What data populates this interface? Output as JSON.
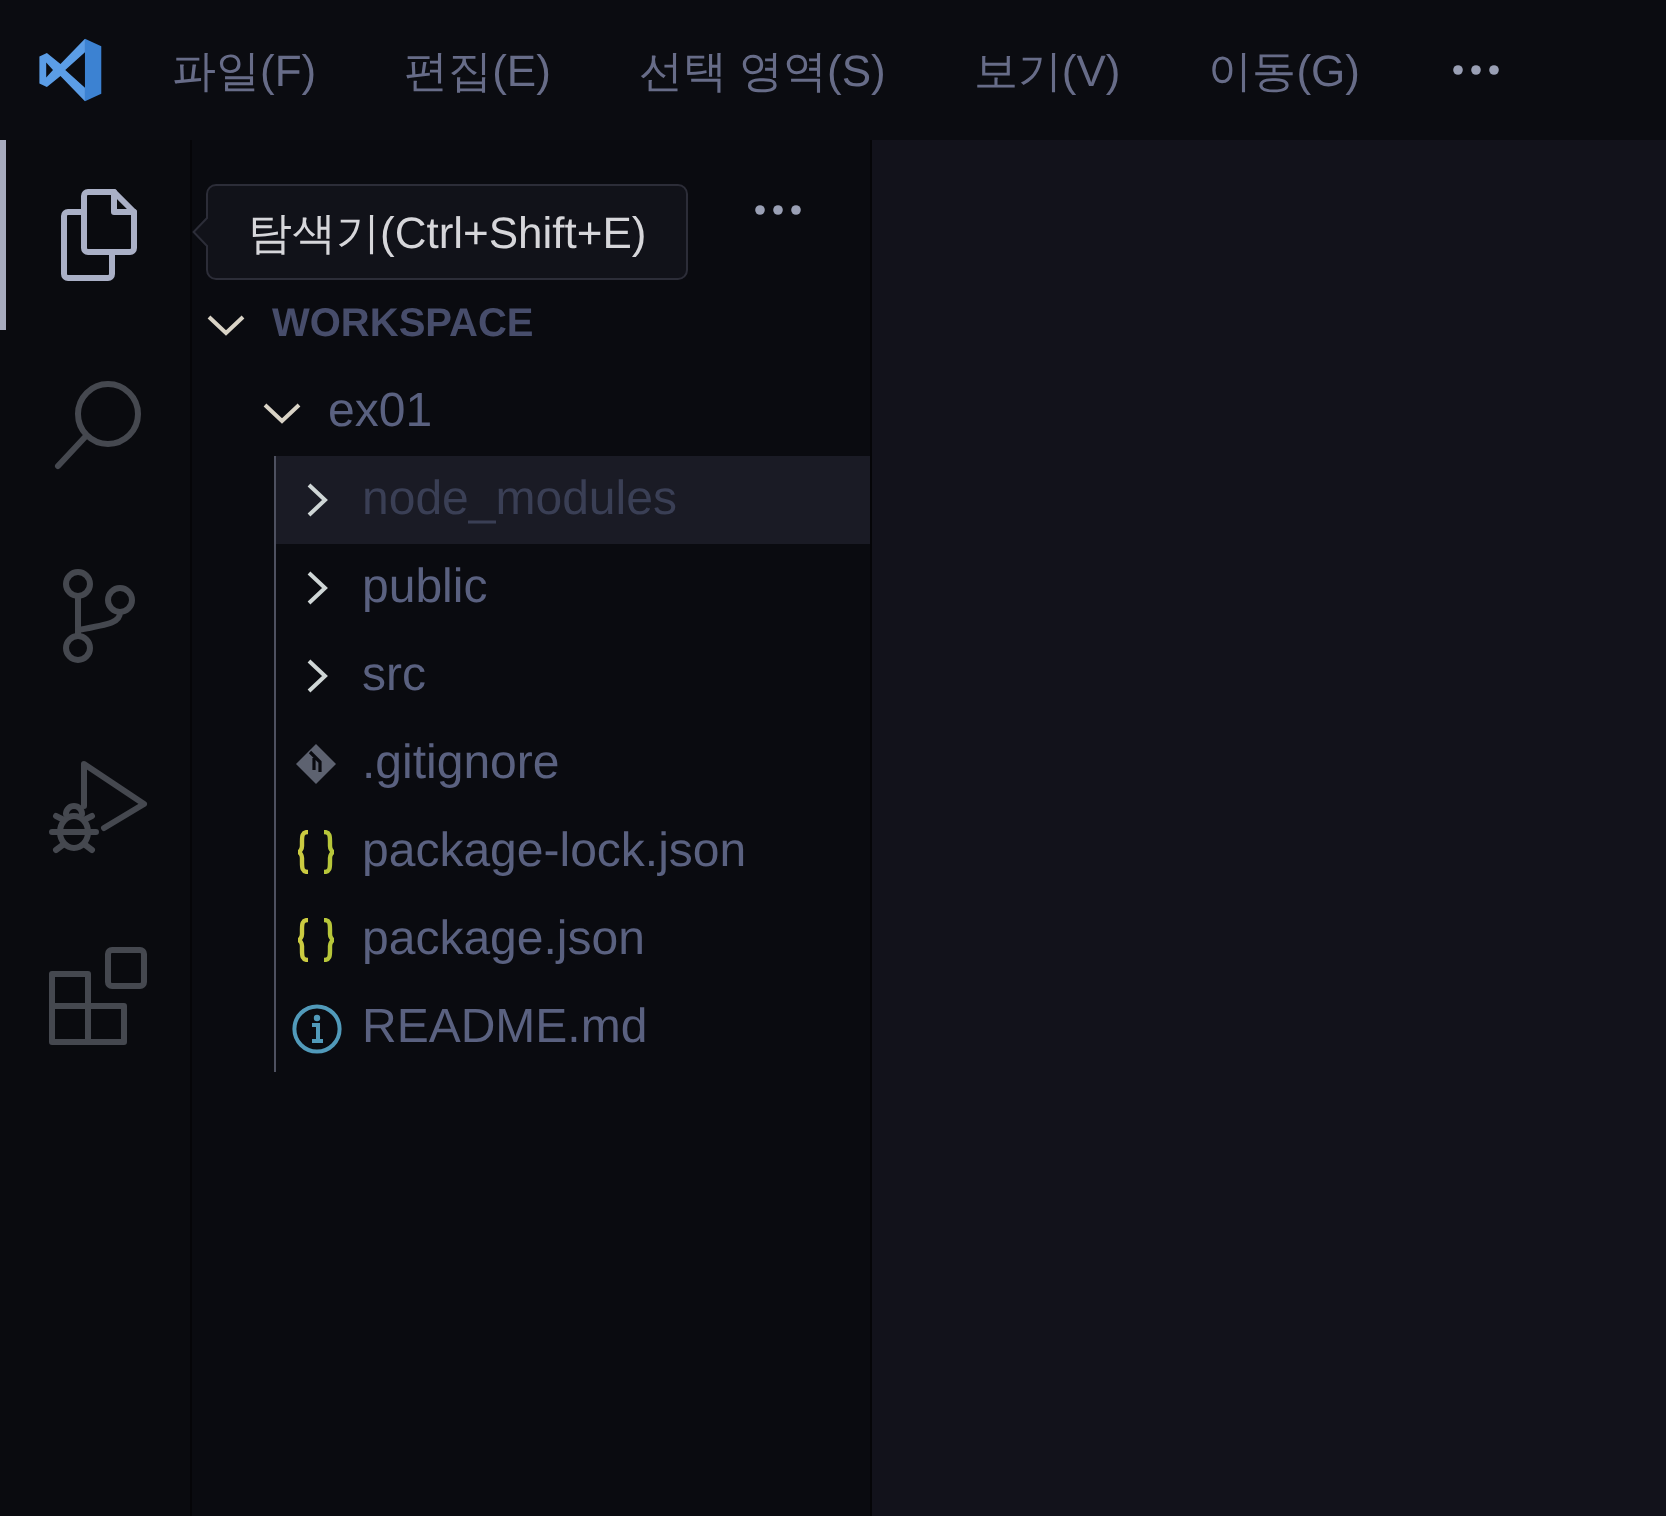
{
  "title_bar": {
    "menu_items": [
      "파일(F)",
      "편집(E)",
      "선택 영역(S)",
      "보기(V)",
      "이동(G)"
    ]
  },
  "activity_bar": {
    "items": [
      {
        "kind": "explorer",
        "selected": true
      },
      {
        "kind": "search",
        "selected": false
      },
      {
        "kind": "source_control",
        "selected": false
      },
      {
        "kind": "run_debug",
        "selected": false
      },
      {
        "kind": "extensions",
        "selected": false
      }
    ]
  },
  "tooltip": {
    "text": "탐색기(Ctrl+Shift+E)"
  },
  "explorer": {
    "tree": [
      {
        "label": "WORKSPACE",
        "kind": "root",
        "expanded": true,
        "selected": false,
        "children": [
          {
            "label": "ex01",
            "kind": "folder",
            "expanded": true,
            "selected": false,
            "children": [
              {
                "label": "node_modules",
                "kind": "folder",
                "expanded": false,
                "ignored": true,
                "selected": true
              },
              {
                "label": "public",
                "kind": "folder",
                "expanded": false,
                "ignored": false,
                "selected": false
              },
              {
                "label": "src",
                "kind": "folder",
                "expanded": false,
                "ignored": false,
                "selected": false
              },
              {
                "label": ".gitignore",
                "kind": "git",
                "ignored": false,
                "selected": false
              },
              {
                "label": "package-lock.json",
                "kind": "json",
                "ignored": false,
                "selected": false
              },
              {
                "label": "package.json",
                "kind": "json",
                "ignored": false,
                "selected": false
              },
              {
                "label": "README.md",
                "kind": "info",
                "ignored": false,
                "selected": false
              }
            ]
          }
        ]
      }
    ]
  }
}
